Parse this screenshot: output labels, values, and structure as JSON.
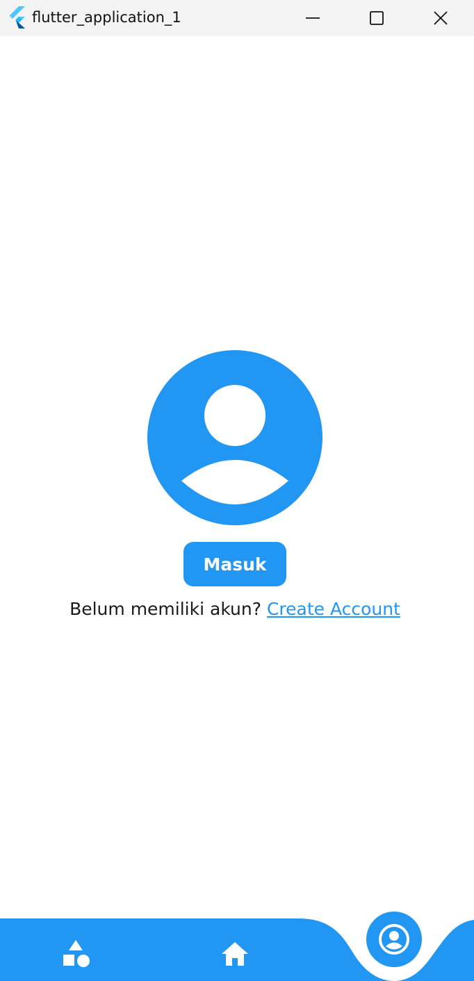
{
  "window": {
    "title": "flutter_application_1",
    "icons": {
      "logo": "flutter-logo-icon",
      "minimize": "minimize-icon",
      "maximize": "maximize-icon",
      "close": "close-icon"
    }
  },
  "main": {
    "avatar_icon": "account-circle-icon",
    "login_button_label": "Masuk",
    "signup_prompt": "Belum memiliki akun?",
    "create_account_link": "Create Account"
  },
  "bottom_nav": {
    "items": [
      {
        "icon": "category-shapes-icon",
        "active": false
      },
      {
        "icon": "home-icon",
        "active": false
      },
      {
        "icon": "account-circle-icon",
        "active": true
      }
    ]
  },
  "colors": {
    "accent": "#2196f3",
    "titlebar": "#f3f3f3",
    "text": "#1a1a1a",
    "background": "#ffffff"
  }
}
